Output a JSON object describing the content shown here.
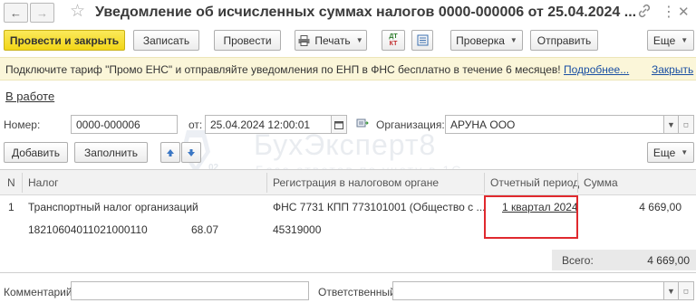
{
  "window": {
    "title": "Уведомление об исчисленных суммах налогов 0000-000006 от 25.04.2024 ...",
    "back_icon": "arrow-left-icon",
    "forward_icon": "arrow-right-icon",
    "favorite_icon": "star-icon",
    "link_icon": "link-icon",
    "more_icon": "vertical-dots-icon",
    "close_icon": "close-icon"
  },
  "toolbar": {
    "post_and_close": "Провести и закрыть",
    "save": "Записать",
    "post": "Провести",
    "print": "Печать",
    "dt_kt_top": "ДТ",
    "dt_kt_bottom": "КТ",
    "check": "Проверка",
    "send": "Отправить",
    "more": "Еще"
  },
  "banner": {
    "text": "Подключите тариф \"Промо ЕНС\" и отправляйте уведомления по ЕНП в ФНС бесплатно в течение 6 месяцев!",
    "more_link": "Подробнее...",
    "close_link": "Закрыть"
  },
  "status": "В работе",
  "form": {
    "number_label": "Номер:",
    "number_value": "0000-000006",
    "date_label": "от:",
    "date_value": "25.04.2024 12:00:01",
    "org_label": "Организация:",
    "org_value": "АРУНА ООО"
  },
  "table_toolbar": {
    "add": "Добавить",
    "fill": "Заполнить",
    "more": "Еще"
  },
  "watermark": {
    "title": "БухЭксперт8",
    "subtitle": "База ответов по учету в 1С"
  },
  "table": {
    "headers": [
      "N",
      "Налог",
      "Регистрация в налоговом органе",
      "Отчетный период",
      "Сумма"
    ],
    "rows": [
      {
        "n": "1",
        "tax": "Транспортный налог организаций",
        "kbk": "18210604011021000110",
        "rate": "68.07",
        "registration": "ФНС 7731 КПП 773101001 (Общество с ...",
        "oktmo": "45319000",
        "period": "1 квартал 2024",
        "amount": "4 669,00"
      }
    ],
    "highlight_color": "#e0292e"
  },
  "totals": {
    "label": "Всего:",
    "value": "4 669,00"
  },
  "footer": {
    "comment_label": "Комментарий:",
    "comment_value": "",
    "responsible_label": "Ответственный:",
    "responsible_value": ""
  }
}
